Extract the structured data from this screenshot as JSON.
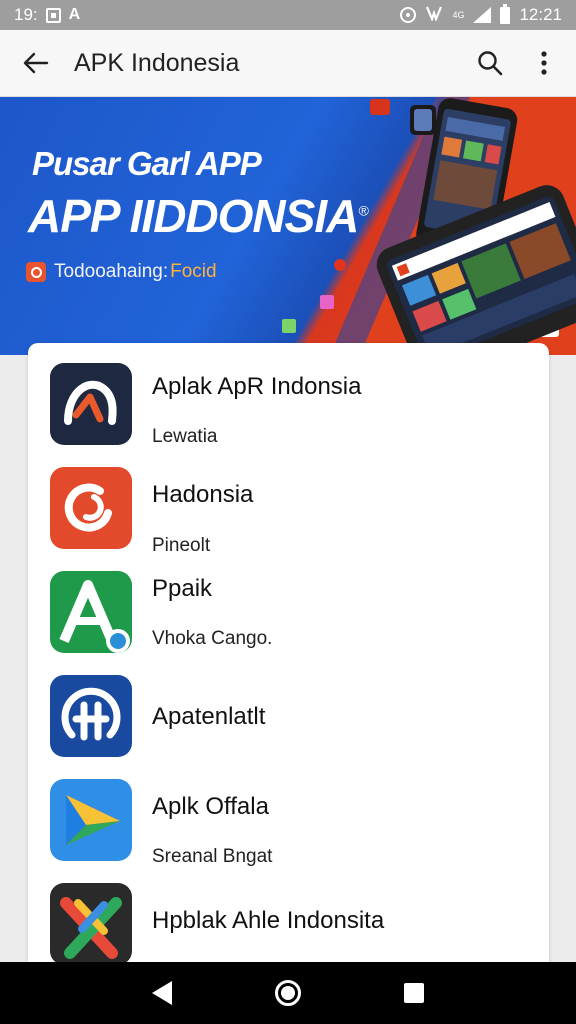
{
  "status_bar": {
    "time_left": "19:",
    "network_label": "4G",
    "time_right": "12:21",
    "icons": [
      "image-icon",
      "a-icon",
      "alarm-icon",
      "vibrate-icon",
      "signal-icon",
      "battery-icon"
    ]
  },
  "app_bar": {
    "title": "APK Indonesia",
    "icons": [
      "back-arrow-icon",
      "search-icon",
      "more-vert-icon"
    ]
  },
  "banner": {
    "line1": "Pusar Garl APP",
    "line2": "APP IIDDONSIA",
    "trademark": "®",
    "subtitle": "Todooahaing:",
    "subtitle_accent": "Focid"
  },
  "apps": [
    {
      "name": "Aplak ApR Indonsia",
      "subtitle": "Lewatia",
      "icon": "wave-logo-icon",
      "color": "#1e2840"
    },
    {
      "name": "Hadonsia",
      "subtitle": "Pineolt",
      "icon": "refresh-logo-icon",
      "color": "#e24a2b"
    },
    {
      "name": "Ppaik",
      "subtitle": "Vhoka  Cango.",
      "icon": "letter-a-logo-icon",
      "color": "#1f9a4a"
    },
    {
      "name": "Apatenlatlt",
      "subtitle": "",
      "icon": "signal-logo-icon",
      "color": "#1a4aa0"
    },
    {
      "name": "Aplk Offala",
      "subtitle": "Sreanal Bngat",
      "icon": "play-logo-icon",
      "color": "#2f8fe6"
    },
    {
      "name": "Hpblak Ahle Indonsita",
      "subtitle": "",
      "icon": "cross-logo-icon",
      "color": "#2a2a2a"
    }
  ],
  "nav_bar": {
    "icons": [
      "nav-back-icon",
      "nav-home-icon",
      "nav-recents-icon"
    ]
  }
}
